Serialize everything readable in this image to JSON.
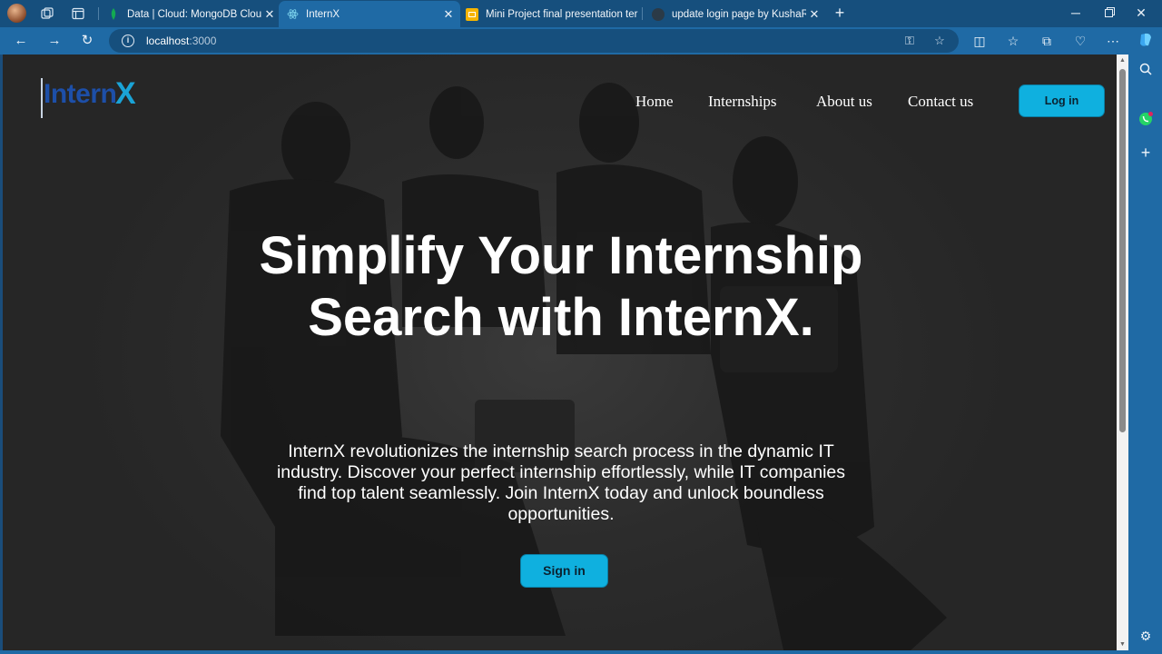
{
  "browser": {
    "tabs": [
      {
        "title": "Data | Cloud: MongoDB Cloud",
        "favicon": "mongodb-leaf-icon",
        "active": false
      },
      {
        "title": "InternX",
        "favicon": "react-icon",
        "active": true
      },
      {
        "title": "Mini Project final presentation ter",
        "favicon": "slides-icon",
        "active": false
      },
      {
        "title": "update login page by KushaRa · P",
        "favicon": "github-icon",
        "active": false
      }
    ],
    "url_host": "localhost",
    "url_port": ":3000"
  },
  "site": {
    "logo_text": "Intern",
    "logo_x": "X",
    "nav": [
      "Home",
      "Internships",
      "About us",
      "Contact us"
    ],
    "login_label": "Log in",
    "hero_title": "Simplify Your Internship Search with InternX.",
    "hero_description": "InternX revolutionizes the internship search process in the dynamic IT industry. Discover your perfect internship effortlessly, while IT companies find top talent seamlessly. Join InternX today and unlock boundless opportunities.",
    "signin_label": "Sign in"
  },
  "colors": {
    "accent": "#0fb0df",
    "chrome": "#1f6aa5",
    "logo_primary": "#1d4fa8",
    "logo_secondary": "#1aa3d6"
  }
}
